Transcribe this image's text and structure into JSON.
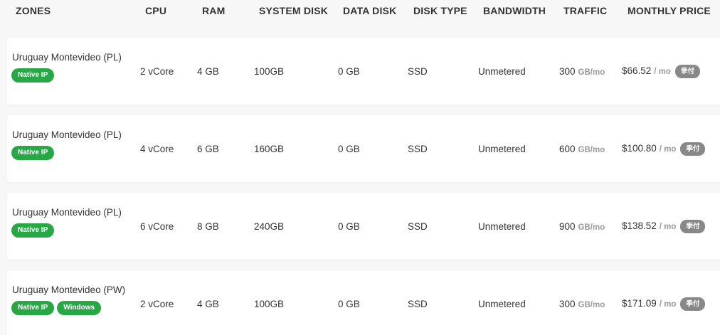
{
  "header": {
    "zones": "ZONES",
    "cpu": "CPU",
    "ram": "RAM",
    "system_disk": "SYSTEM DISK",
    "data_disk": "DATA DISK",
    "disk_type": "DISK TYPE",
    "bandwidth": "BANDWIDTH",
    "traffic": "TRAFFIC",
    "monthly_price": "MONTHLY PRICE"
  },
  "rows": [
    {
      "zone": "Uruguay Montevideo (PL)",
      "badges": [
        "Native IP"
      ],
      "cpu": "2 vCore",
      "ram": "4 GB",
      "system_disk": "100GB",
      "data_disk": "0 GB",
      "disk_type": "SSD",
      "bandwidth": "Unmetered",
      "traffic": "300",
      "traffic_unit": "GB/mo",
      "price": "$66.52",
      "per": "/ mo",
      "pay": "季付"
    },
    {
      "zone": "Uruguay Montevideo (PL)",
      "badges": [
        "Native IP"
      ],
      "cpu": "4 vCore",
      "ram": "6 GB",
      "system_disk": "160GB",
      "data_disk": "0 GB",
      "disk_type": "SSD",
      "bandwidth": "Unmetered",
      "traffic": "600",
      "traffic_unit": "GB/mo",
      "price": "$100.80",
      "per": "/ mo",
      "pay": "季付"
    },
    {
      "zone": "Uruguay Montevideo (PL)",
      "badges": [
        "Native IP"
      ],
      "cpu": "6 vCore",
      "ram": "8 GB",
      "system_disk": "240GB",
      "data_disk": "0 GB",
      "disk_type": "SSD",
      "bandwidth": "Unmetered",
      "traffic": "900",
      "traffic_unit": "GB/mo",
      "price": "$138.52",
      "per": "/ mo",
      "pay": "季付"
    },
    {
      "zone": "Uruguay Montevideo (PW)",
      "badges": [
        "Native IP",
        "Windows"
      ],
      "cpu": "2 vCore",
      "ram": "4 GB",
      "system_disk": "100GB",
      "data_disk": "0 GB",
      "disk_type": "SSD",
      "bandwidth": "Unmetered",
      "traffic": "300",
      "traffic_unit": "GB/mo",
      "price": "$171.09",
      "per": "/ mo",
      "pay": "季付"
    }
  ],
  "colors": {
    "badge_green": "#28a745",
    "pay_badge_gray": "#888888",
    "row_bg": "#ffffff",
    "page_bg": "#f7f7f7"
  }
}
